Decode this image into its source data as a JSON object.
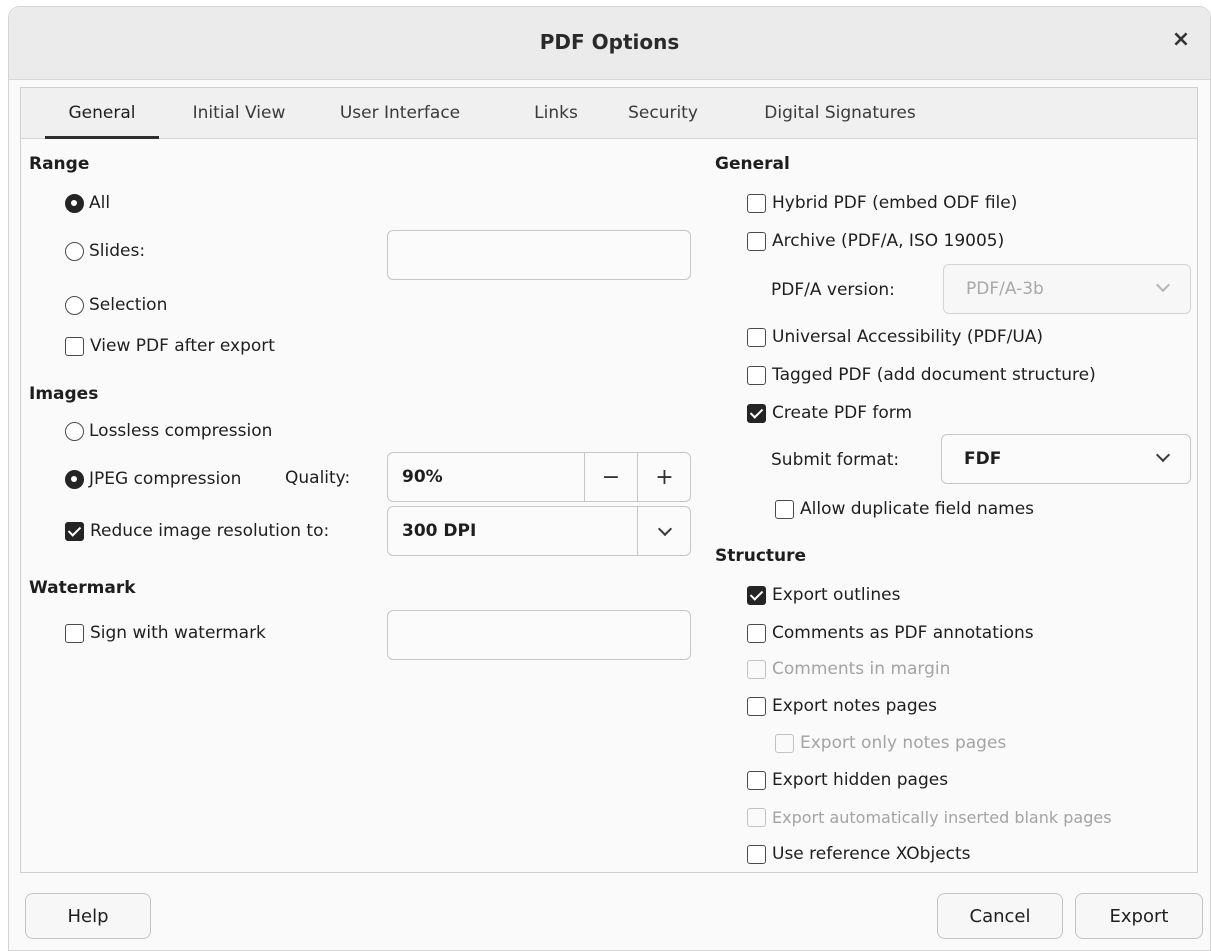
{
  "dialog": {
    "title": "PDF Options",
    "close_glyph": "×"
  },
  "tabs": [
    {
      "label": "General"
    },
    {
      "label": "Initial View"
    },
    {
      "label": "User Interface"
    },
    {
      "label": "Links"
    },
    {
      "label": "Security"
    },
    {
      "label": "Digital Signatures"
    }
  ],
  "range": {
    "heading": "Range",
    "all": "All",
    "slides": "Slides:",
    "slides_value": "",
    "selection": "Selection",
    "view_after_export": "View PDF after export"
  },
  "images": {
    "heading": "Images",
    "lossless": "Lossless compression",
    "jpeg": "JPEG compression",
    "quality_label": "Quality:",
    "quality_value": "90%",
    "minus": "−",
    "plus": "+",
    "reduce": "Reduce image resolution to:",
    "resolution_value": "300 DPI"
  },
  "watermark": {
    "heading": "Watermark",
    "sign": "Sign with watermark",
    "value": ""
  },
  "general": {
    "heading": "General",
    "hybrid": "Hybrid PDF (embed ODF file)",
    "archive": "Archive (PDF/A, ISO 19005)",
    "pdfa_label": "PDF/A version:",
    "pdfa_value": "PDF/A-3b",
    "accessibility": "Universal Accessibility (PDF/UA)",
    "tagged": "Tagged PDF (add document structure)",
    "create_form": "Create PDF form",
    "submit_label": "Submit format:",
    "submit_value": "FDF",
    "allow_duplicate": "Allow duplicate field names"
  },
  "structure": {
    "heading": "Structure",
    "outlines": "Export outlines",
    "comments_pdf": "Comments as PDF annotations",
    "comments_margin": "Comments in margin",
    "notes_pages": "Export notes pages",
    "only_notes": "Export only notes pages",
    "hidden_pages": "Export hidden pages",
    "blank_pages": "Export automatically inserted blank pages",
    "xobjects": "Use reference XObjects"
  },
  "buttons": {
    "help": "Help",
    "cancel": "Cancel",
    "export": "Export"
  }
}
